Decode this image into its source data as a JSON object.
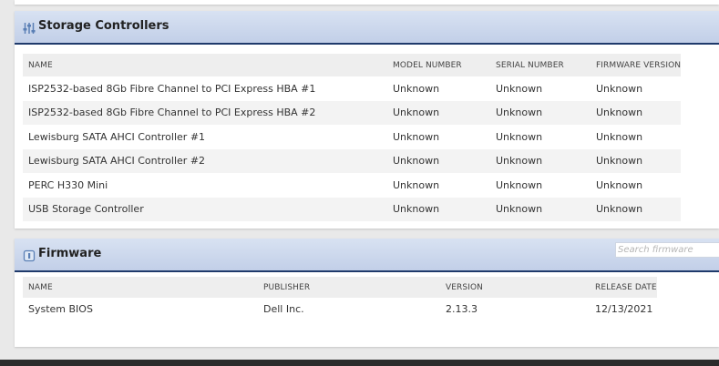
{
  "storage": {
    "title": "Storage Controllers",
    "icon": "sliders-icon",
    "columns": [
      "NAME",
      "MODEL NUMBER",
      "SERIAL NUMBER",
      "FIRMWARE VERSION"
    ],
    "rows": [
      [
        "ISP2532-based 8Gb Fibre Channel to PCI Express HBA #1",
        "Unknown",
        "Unknown",
        "Unknown"
      ],
      [
        "ISP2532-based 8Gb Fibre Channel to PCI Express HBA #2",
        "Unknown",
        "Unknown",
        "Unknown"
      ],
      [
        "Lewisburg SATA AHCI Controller #1",
        "Unknown",
        "Unknown",
        "Unknown"
      ],
      [
        "Lewisburg SATA AHCI Controller #2",
        "Unknown",
        "Unknown",
        "Unknown"
      ],
      [
        "PERC H330 Mini",
        "Unknown",
        "Unknown",
        "Unknown"
      ],
      [
        "USB Storage Controller",
        "Unknown",
        "Unknown",
        "Unknown"
      ]
    ]
  },
  "firmware": {
    "title": "Firmware",
    "icon": "firmware-chip-icon",
    "search": {
      "placeholder": "Search firmware",
      "value": ""
    },
    "columns": [
      "NAME",
      "PUBLISHER",
      "VERSION",
      "RELEASE DATE"
    ],
    "rows": [
      [
        "System BIOS",
        "Dell Inc.",
        "2.13.3",
        "12/13/2021"
      ]
    ]
  },
  "colors": {
    "header_gradient_top": "#d8e2f2",
    "header_gradient_bottom": "#c2cfe8",
    "header_rule": "#1f3a6b",
    "icon": "#5a7fb5"
  }
}
